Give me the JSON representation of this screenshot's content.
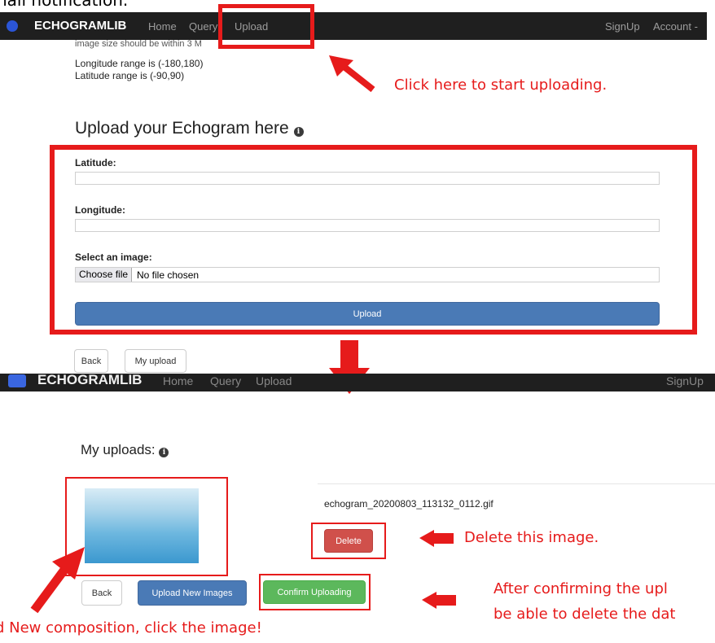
{
  "caption_top": "nail notification.",
  "nav1": {
    "brand": "ECHOGRAMLIB",
    "home": "Home",
    "query": "Query",
    "upload": "Upload",
    "signup": "SignUp",
    "account": "Account -"
  },
  "info_lines": {
    "size_partial": "image size should be within 3 M",
    "lon": "Longitude range is (-180,180)",
    "lat": "Latitude range is (-90,90)"
  },
  "annot_upload": "Click here to start uploading.",
  "upload_heading": "Upload your Echogram here",
  "form": {
    "latitude_label": "Latitude:",
    "longitude_label": "Longitude:",
    "image_label": "Select an image:",
    "choose_file": "Choose file",
    "no_file": "No file chosen",
    "upload_button": "Upload"
  },
  "buttons1": {
    "back": "Back",
    "my_upload": "My upload"
  },
  "nav2": {
    "brand": "ECHOGRAMLIB",
    "home": "Home",
    "query": "Query",
    "upload": "Upload",
    "signup": "SignUp"
  },
  "my_uploads_heading": "My uploads:",
  "file_name": "echogram_20200803_113132_0112.gif",
  "buttons2": {
    "delete": "Delete",
    "back": "Back",
    "upload_new": "Upload New Images",
    "confirm": "Confirm Uploading"
  },
  "annot_delete": "Delete this image.",
  "annot_confirm_line1": "After confirming the upl",
  "annot_confirm_line2": "be able to delete the dat",
  "annot_composition": "d New composition, click the image!",
  "colors": {
    "annotation_red": "#e61b1b",
    "navbar": "#1f1f1f",
    "primary_blue": "#4a7ab6",
    "danger_red": "#d0504b",
    "success_green": "#5cb85c"
  }
}
